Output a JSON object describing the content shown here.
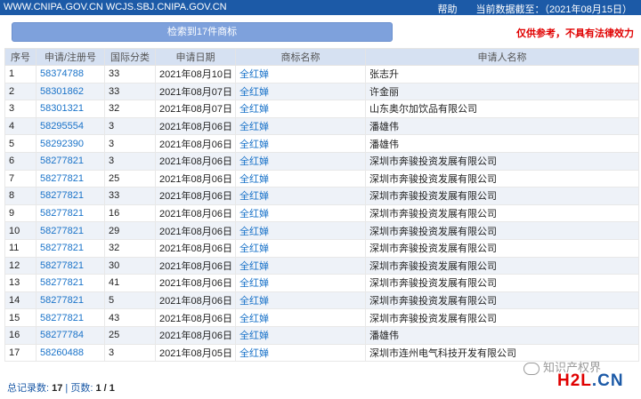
{
  "header": {
    "sites": "WWW.CNIPA.GOV.CN  WCJS.SBJ.CNIPA.GOV.CN",
    "help": "帮助",
    "data_date": "当前数据截至：（2021年08月15日）"
  },
  "search_result_label": "检索到17件商标",
  "disclaimer": "仅供参考，不具有法律效力",
  "columns": [
    "序号",
    "申请/注册号",
    "国际分类",
    "申请日期",
    "商标名称",
    "申请人名称"
  ],
  "rows": [
    {
      "no": "1",
      "reg": "58374788",
      "cls": "33",
      "date": "2021年08月10日",
      "mark": "全红婵",
      "applicant": "张志升"
    },
    {
      "no": "2",
      "reg": "58301862",
      "cls": "33",
      "date": "2021年08月07日",
      "mark": "全红婵",
      "applicant": "许金丽"
    },
    {
      "no": "3",
      "reg": "58301321",
      "cls": "32",
      "date": "2021年08月07日",
      "mark": "全红婵",
      "applicant": "山东奥尔加饮品有限公司"
    },
    {
      "no": "4",
      "reg": "58295554",
      "cls": "3",
      "date": "2021年08月06日",
      "mark": "全红婵",
      "applicant": "潘雄伟"
    },
    {
      "no": "5",
      "reg": "58292390",
      "cls": "3",
      "date": "2021年08月06日",
      "mark": "全红婵",
      "applicant": "潘雄伟"
    },
    {
      "no": "6",
      "reg": "58277821",
      "cls": "3",
      "date": "2021年08月06日",
      "mark": "全红婵",
      "applicant": "深圳市奔骏投资发展有限公司"
    },
    {
      "no": "7",
      "reg": "58277821",
      "cls": "25",
      "date": "2021年08月06日",
      "mark": "全红婵",
      "applicant": "深圳市奔骏投资发展有限公司"
    },
    {
      "no": "8",
      "reg": "58277821",
      "cls": "33",
      "date": "2021年08月06日",
      "mark": "全红婵",
      "applicant": "深圳市奔骏投资发展有限公司"
    },
    {
      "no": "9",
      "reg": "58277821",
      "cls": "16",
      "date": "2021年08月06日",
      "mark": "全红婵",
      "applicant": "深圳市奔骏投资发展有限公司"
    },
    {
      "no": "10",
      "reg": "58277821",
      "cls": "29",
      "date": "2021年08月06日",
      "mark": "全红婵",
      "applicant": "深圳市奔骏投资发展有限公司"
    },
    {
      "no": "11",
      "reg": "58277821",
      "cls": "32",
      "date": "2021年08月06日",
      "mark": "全红婵",
      "applicant": "深圳市奔骏投资发展有限公司"
    },
    {
      "no": "12",
      "reg": "58277821",
      "cls": "30",
      "date": "2021年08月06日",
      "mark": "全红婵",
      "applicant": "深圳市奔骏投资发展有限公司"
    },
    {
      "no": "13",
      "reg": "58277821",
      "cls": "41",
      "date": "2021年08月06日",
      "mark": "全红婵",
      "applicant": "深圳市奔骏投资发展有限公司"
    },
    {
      "no": "14",
      "reg": "58277821",
      "cls": "5",
      "date": "2021年08月06日",
      "mark": "全红婵",
      "applicant": "深圳市奔骏投资发展有限公司"
    },
    {
      "no": "15",
      "reg": "58277821",
      "cls": "43",
      "date": "2021年08月06日",
      "mark": "全红婵",
      "applicant": "深圳市奔骏投资发展有限公司"
    },
    {
      "no": "16",
      "reg": "58277784",
      "cls": "25",
      "date": "2021年08月06日",
      "mark": "全红婵",
      "applicant": "潘雄伟"
    },
    {
      "no": "17",
      "reg": "58260488",
      "cls": "3",
      "date": "2021年08月05日",
      "mark": "全红婵",
      "applicant": "深圳市连州电气科技开发有限公司"
    }
  ],
  "footer": {
    "total_label": "总记录数:",
    "total": "17",
    "sep": " | ",
    "pages_label": "页数:",
    "pages": "1 / 1"
  },
  "watermark": {
    "wechat": "知识产权界",
    "brand_h2l": "H2L",
    "brand_cn": ".CN"
  }
}
